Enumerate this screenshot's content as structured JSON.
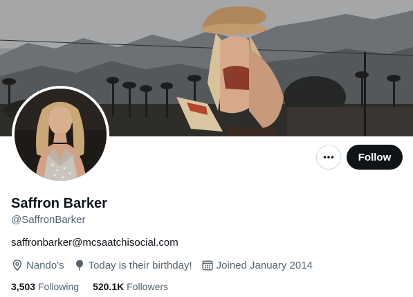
{
  "profile": {
    "name": "Saffron Barker",
    "handle": "@SaffronBarker",
    "bio": "saffronbarker@mcsaatchisocial.com",
    "location": "Nando's",
    "birthday": "Today is their birthday!",
    "joined": "Joined January 2014",
    "following_count": "3,503",
    "following_label": "Following",
    "followers_count": "520.1K",
    "followers_label": "Followers"
  },
  "actions": {
    "follow_label": "Follow",
    "more_icon": "more-horizontal-icon"
  },
  "icons": {
    "location": "location-pin-icon",
    "birthday": "balloon-icon",
    "joined": "calendar-icon"
  },
  "colors": {
    "text_primary": "#0f1419",
    "text_secondary": "#536471",
    "follow_button_bg": "#0f1419",
    "follow_button_text": "#ffffff",
    "border": "#cfd9de"
  }
}
